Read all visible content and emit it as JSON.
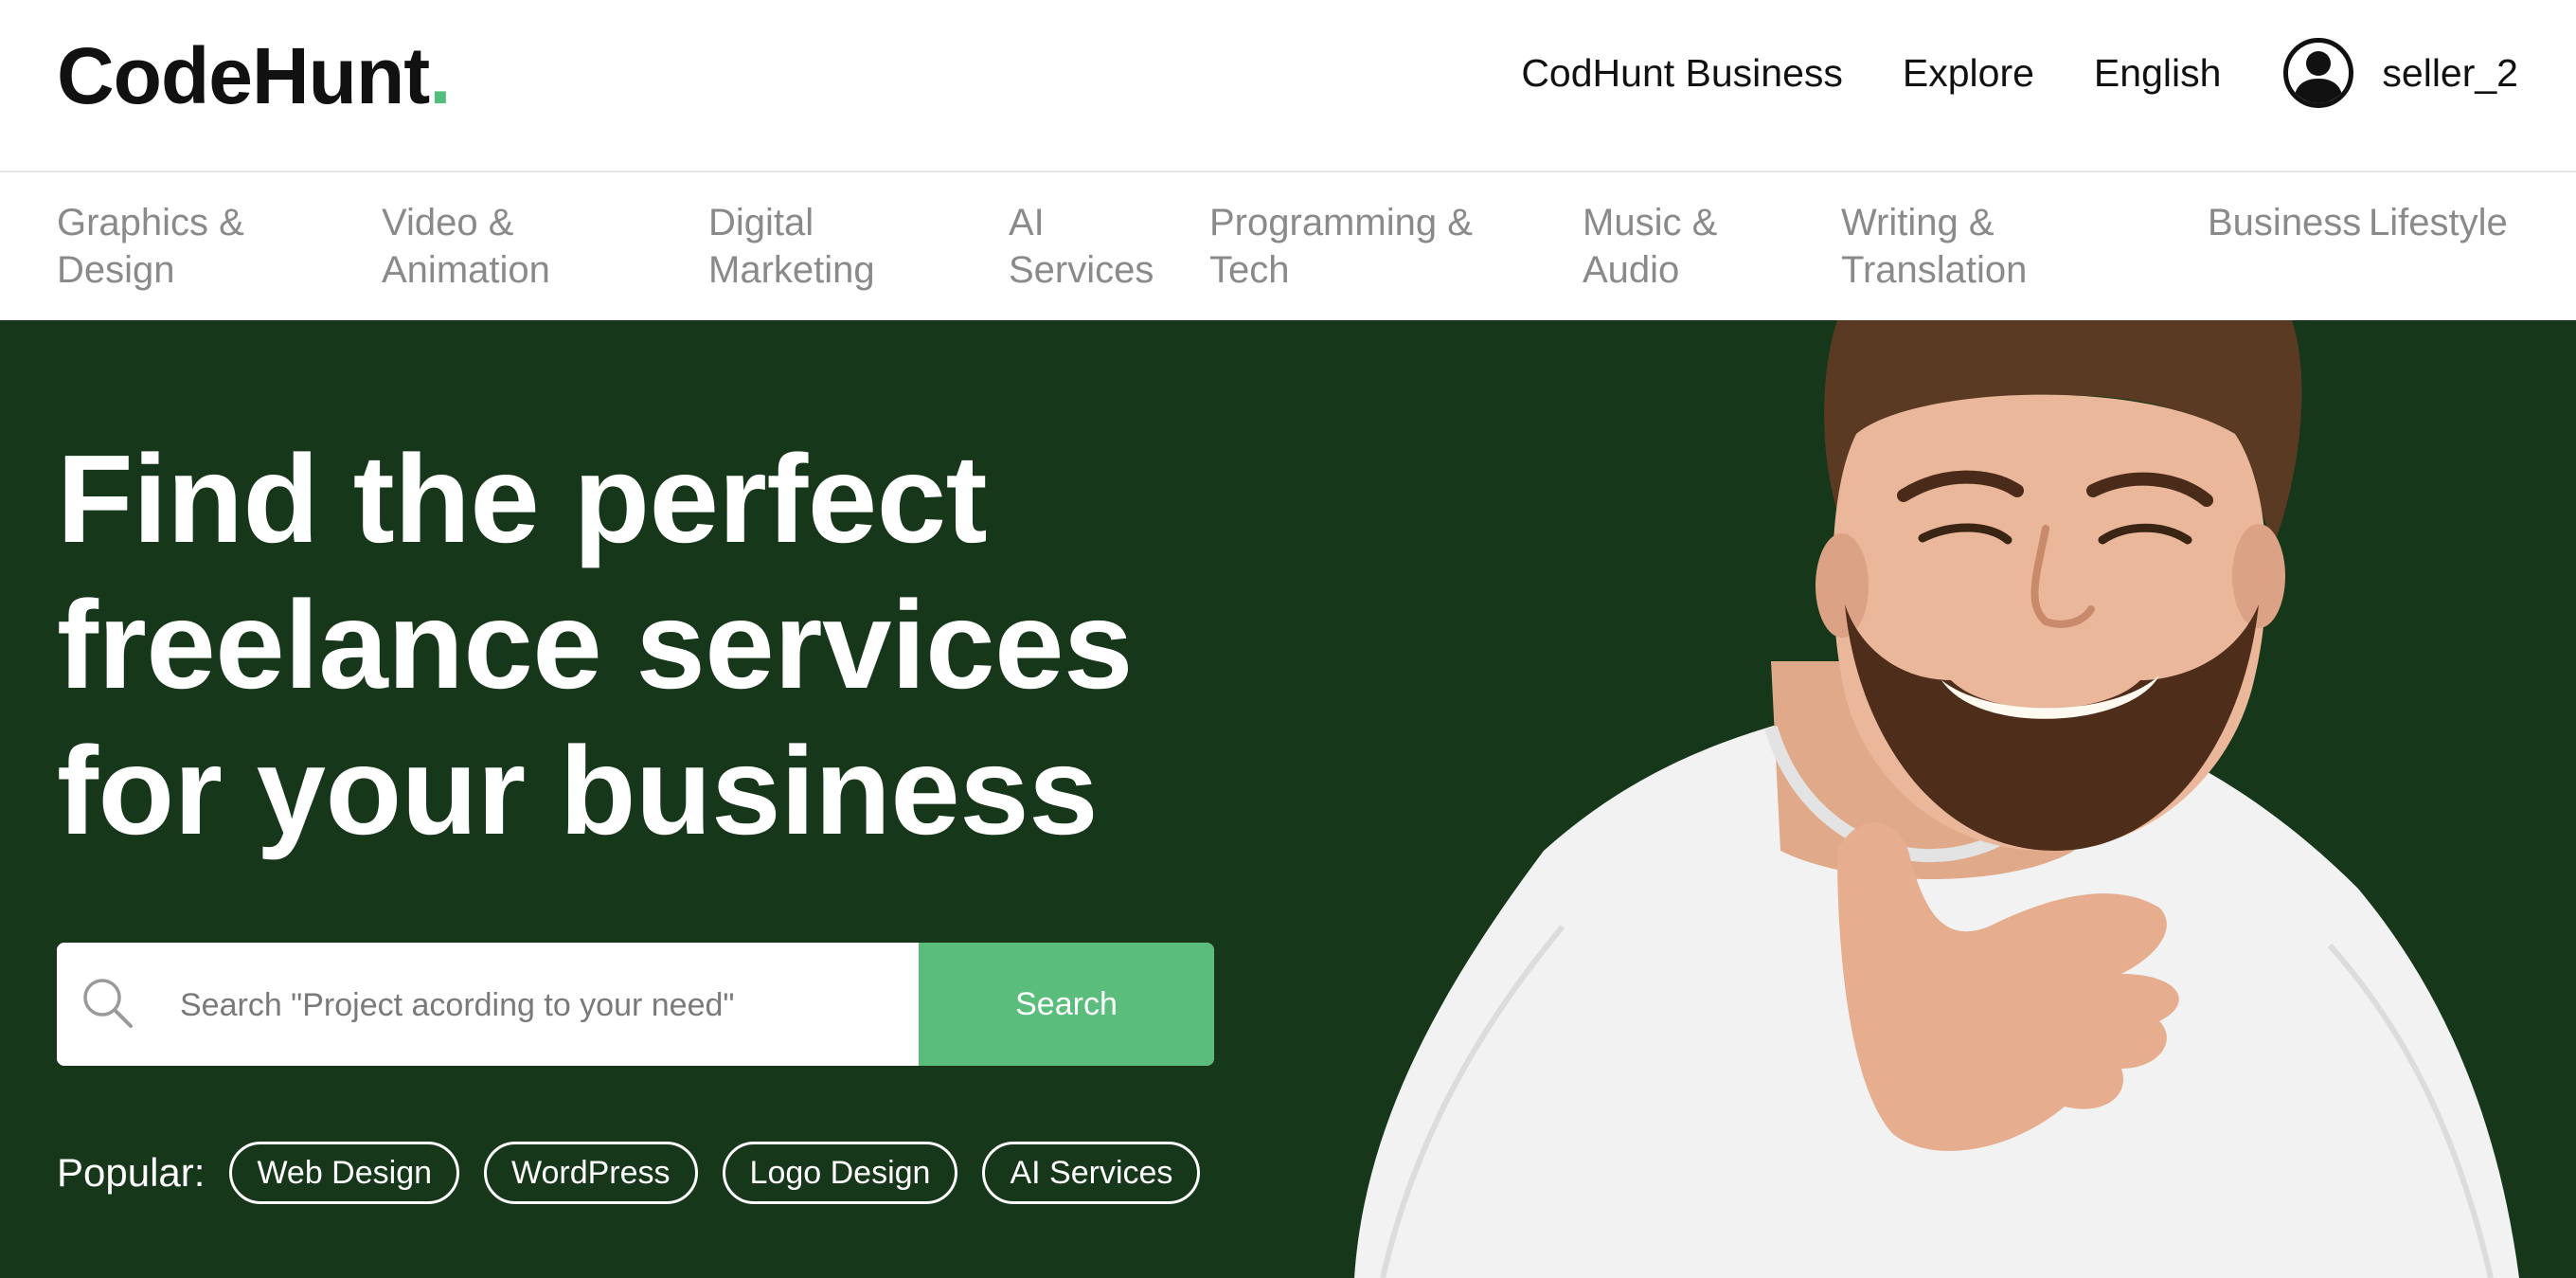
{
  "header": {
    "logo_text": "CodeHunt",
    "logo_dot": ".",
    "nav": [
      {
        "label": "CodHunt Business"
      },
      {
        "label": "Explore"
      },
      {
        "label": "English"
      }
    ],
    "user": {
      "icon": "user-avatar-icon",
      "name": "seller_2"
    }
  },
  "categories": [
    "Graphics &\nDesign",
    "Video &\nAnimation",
    "Digital\nMarketing",
    "AI\nServices",
    "Programming &\nTech",
    "Music &\nAudio",
    "Writing &\nTranslation",
    "Business",
    "Lifestyle"
  ],
  "hero": {
    "headline_lines": [
      "Find the perfect",
      "freelance services",
      "for your business"
    ],
    "search": {
      "icon": "search-icon",
      "placeholder": "Search \"Project acording to your need\"",
      "value": "",
      "button_label": "Search"
    },
    "popular_label": "Popular:",
    "popular_tags": [
      "Web Design",
      "WordPress",
      "Logo Design",
      "AI Services"
    ]
  },
  "colors": {
    "hero_bg": "#17371a",
    "accent": "#5abd7b",
    "logo_dot": "#4fbf7a",
    "category_text": "#8a8a8a"
  }
}
